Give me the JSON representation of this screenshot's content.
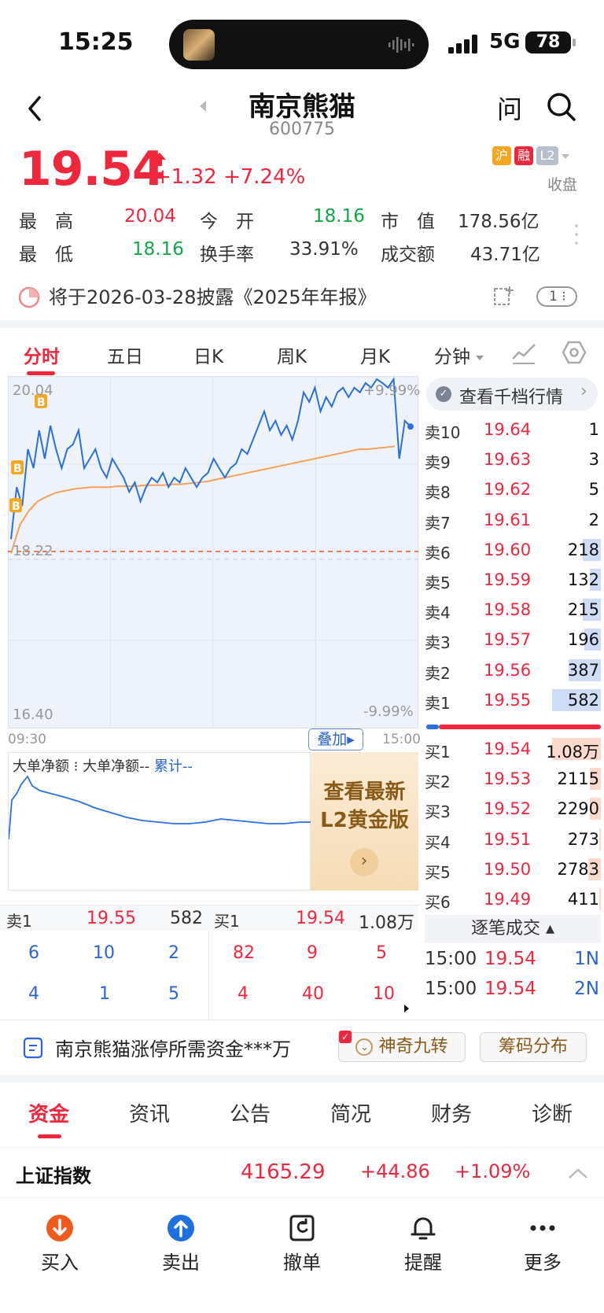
{
  "status_bar": {
    "time": "15:25",
    "network": "5G",
    "battery": "78"
  },
  "header": {
    "name": "南京熊猫",
    "code": "600775",
    "ask_label": "问"
  },
  "quote": {
    "price": "19.54",
    "change": "+1.32",
    "change_pct": "+7.24%",
    "tags": [
      "沪",
      "融",
      "L2"
    ],
    "session_status": "收盘",
    "stats": {
      "high_label": "最　高",
      "high": "20.04",
      "open_label": "今　开",
      "open": "18.16",
      "mcap_label": "市　值",
      "mcap": "178.56亿",
      "low_label": "最　低",
      "low": "18.16",
      "turnover_label": "换手率",
      "turnover": "33.91%",
      "amount_label": "成交额",
      "amount": "43.71亿"
    }
  },
  "notice": {
    "text": "将于2026-03-28披露《2025年年报》",
    "badge": "1"
  },
  "chart_tabs": [
    {
      "label": "分时",
      "active": true
    },
    {
      "label": "五日"
    },
    {
      "label": "日K"
    },
    {
      "label": "周K"
    },
    {
      "label": "月K"
    },
    {
      "label": "分钟"
    }
  ],
  "chart_data": {
    "type": "line",
    "ylim": [
      16.4,
      20.04
    ],
    "y_top_label": "20.04",
    "y_mid_label": "18.22",
    "y_bottom_label": "16.40",
    "pct_top_label": "+9.99%",
    "pct_bottom_label": "-9.99%",
    "x_start_label": "09:30",
    "x_end_label": "15:00",
    "prev_close": 18.22,
    "trade_markers": [
      "B",
      "B",
      "B"
    ],
    "series": [
      {
        "values": [
          18.35,
          18.9,
          18.7,
          19.3,
          19.1,
          19.5,
          19.2,
          19.55,
          19.3,
          19.1,
          19.3,
          19.35,
          19.5,
          19.1,
          19.2,
          19.3,
          19.1,
          19.0,
          19.2,
          19.1,
          19.0,
          18.85,
          18.95,
          18.75,
          18.9,
          19.0,
          18.95,
          19.05,
          18.9,
          19.0,
          18.95,
          19.1,
          19.0,
          18.9,
          19.0,
          19.05,
          19.2,
          19.1,
          19.0,
          19.1,
          19.15,
          19.3,
          19.25,
          19.4,
          19.55,
          19.7,
          19.5,
          19.6,
          19.45,
          19.55,
          19.4,
          19.6,
          19.9,
          19.8,
          19.95,
          19.7,
          19.85,
          19.75,
          19.9,
          19.95,
          19.85,
          19.95,
          19.9,
          20.0,
          19.95,
          20.04,
          20.0,
          19.95,
          20.04,
          19.2,
          19.6,
          19.54
        ]
      },
      {
        "values": [
          18.2,
          18.5,
          18.65,
          18.75,
          18.8,
          18.84,
          18.86,
          18.88,
          18.89,
          18.9,
          18.9,
          18.9,
          18.91,
          18.91,
          18.91,
          18.92,
          18.92,
          18.92,
          18.93,
          18.93,
          18.94,
          18.95,
          18.96,
          18.98,
          19.0,
          19.02,
          19.04,
          19.06,
          19.08,
          19.1,
          19.12,
          19.14,
          19.16,
          19.18,
          19.2,
          19.22,
          19.24,
          19.26,
          19.28,
          19.3,
          19.3,
          19.31,
          19.32,
          19.33
        ]
      }
    ]
  },
  "overlay_label": "叠加",
  "net_flow": {
    "title": "大单净额",
    "legend_a": "大单净额--",
    "legend_b": "累计--"
  },
  "promo": {
    "line1": "查看最新",
    "line2": "L2黄金版"
  },
  "order_book": {
    "header": "查看千档行情",
    "asks": [
      {
        "label": "卖10",
        "price": "19.64",
        "qty": "1",
        "bar": 0
      },
      {
        "label": "卖9",
        "price": "19.63",
        "qty": "3",
        "bar": 0
      },
      {
        "label": "卖8",
        "price": "19.62",
        "qty": "5",
        "bar": 0
      },
      {
        "label": "卖7",
        "price": "19.61",
        "qty": "2",
        "bar": 0
      },
      {
        "label": "卖6",
        "price": "19.60",
        "qty": "218",
        "bar": 0.1
      },
      {
        "label": "卖5",
        "price": "19.59",
        "qty": "132",
        "bar": 0.06
      },
      {
        "label": "卖4",
        "price": "19.58",
        "qty": "215",
        "bar": 0.1
      },
      {
        "label": "卖3",
        "price": "19.57",
        "qty": "196",
        "bar": 0.09
      },
      {
        "label": "卖2",
        "price": "19.56",
        "qty": "387",
        "bar": 0.18
      },
      {
        "label": "卖1",
        "price": "19.55",
        "qty": "582",
        "bar": 0.27
      }
    ],
    "bids": [
      {
        "label": "买1",
        "price": "19.54",
        "qty": "1.08万",
        "bar": 0.27
      },
      {
        "label": "买2",
        "price": "19.53",
        "qty": "2115",
        "bar": 0.06
      },
      {
        "label": "买3",
        "price": "19.52",
        "qty": "2290",
        "bar": 0.06
      },
      {
        "label": "买4",
        "price": "19.51",
        "qty": "273",
        "bar": 0.01
      },
      {
        "label": "买5",
        "price": "19.50",
        "qty": "2783",
        "bar": 0.07
      },
      {
        "label": "买6",
        "price": "19.49",
        "qty": "411",
        "bar": 0.01
      }
    ]
  },
  "trades": {
    "header": "逐笔成交",
    "rows": [
      {
        "time": "15:00",
        "price": "19.54",
        "vol": "1N"
      },
      {
        "time": "15:00",
        "price": "19.54",
        "vol": "2N"
      }
    ]
  },
  "queue": {
    "ask_label": "卖1",
    "ask_price": "19.55",
    "ask_qty": "582",
    "bid_label": "买1",
    "bid_price": "19.54",
    "bid_qty": "1.08万",
    "ask_cells": [
      "6",
      "10",
      "2",
      "4",
      "1",
      "5"
    ],
    "bid_cells": [
      "82",
      "9",
      "5",
      "4",
      "40",
      "10"
    ]
  },
  "funding": {
    "text": "南京熊猫涨停所需资金***万",
    "pill1": "神奇九转",
    "pill2": "筹码分布"
  },
  "bottom_tabs": [
    "资金",
    "资讯",
    "公告",
    "简况",
    "财务",
    "诊断"
  ],
  "index": {
    "name": "上证指数",
    "value": "4165.29",
    "change": "+44.86",
    "pct": "+1.09%"
  },
  "nav": [
    {
      "label": "买入"
    },
    {
      "label": "卖出"
    },
    {
      "label": "撤单"
    },
    {
      "label": "提醒"
    },
    {
      "label": "更多"
    }
  ],
  "colors": {
    "up": "#f0263d",
    "down": "#10a848",
    "line": "#2b6fe0",
    "avg": "#f5a25b"
  }
}
